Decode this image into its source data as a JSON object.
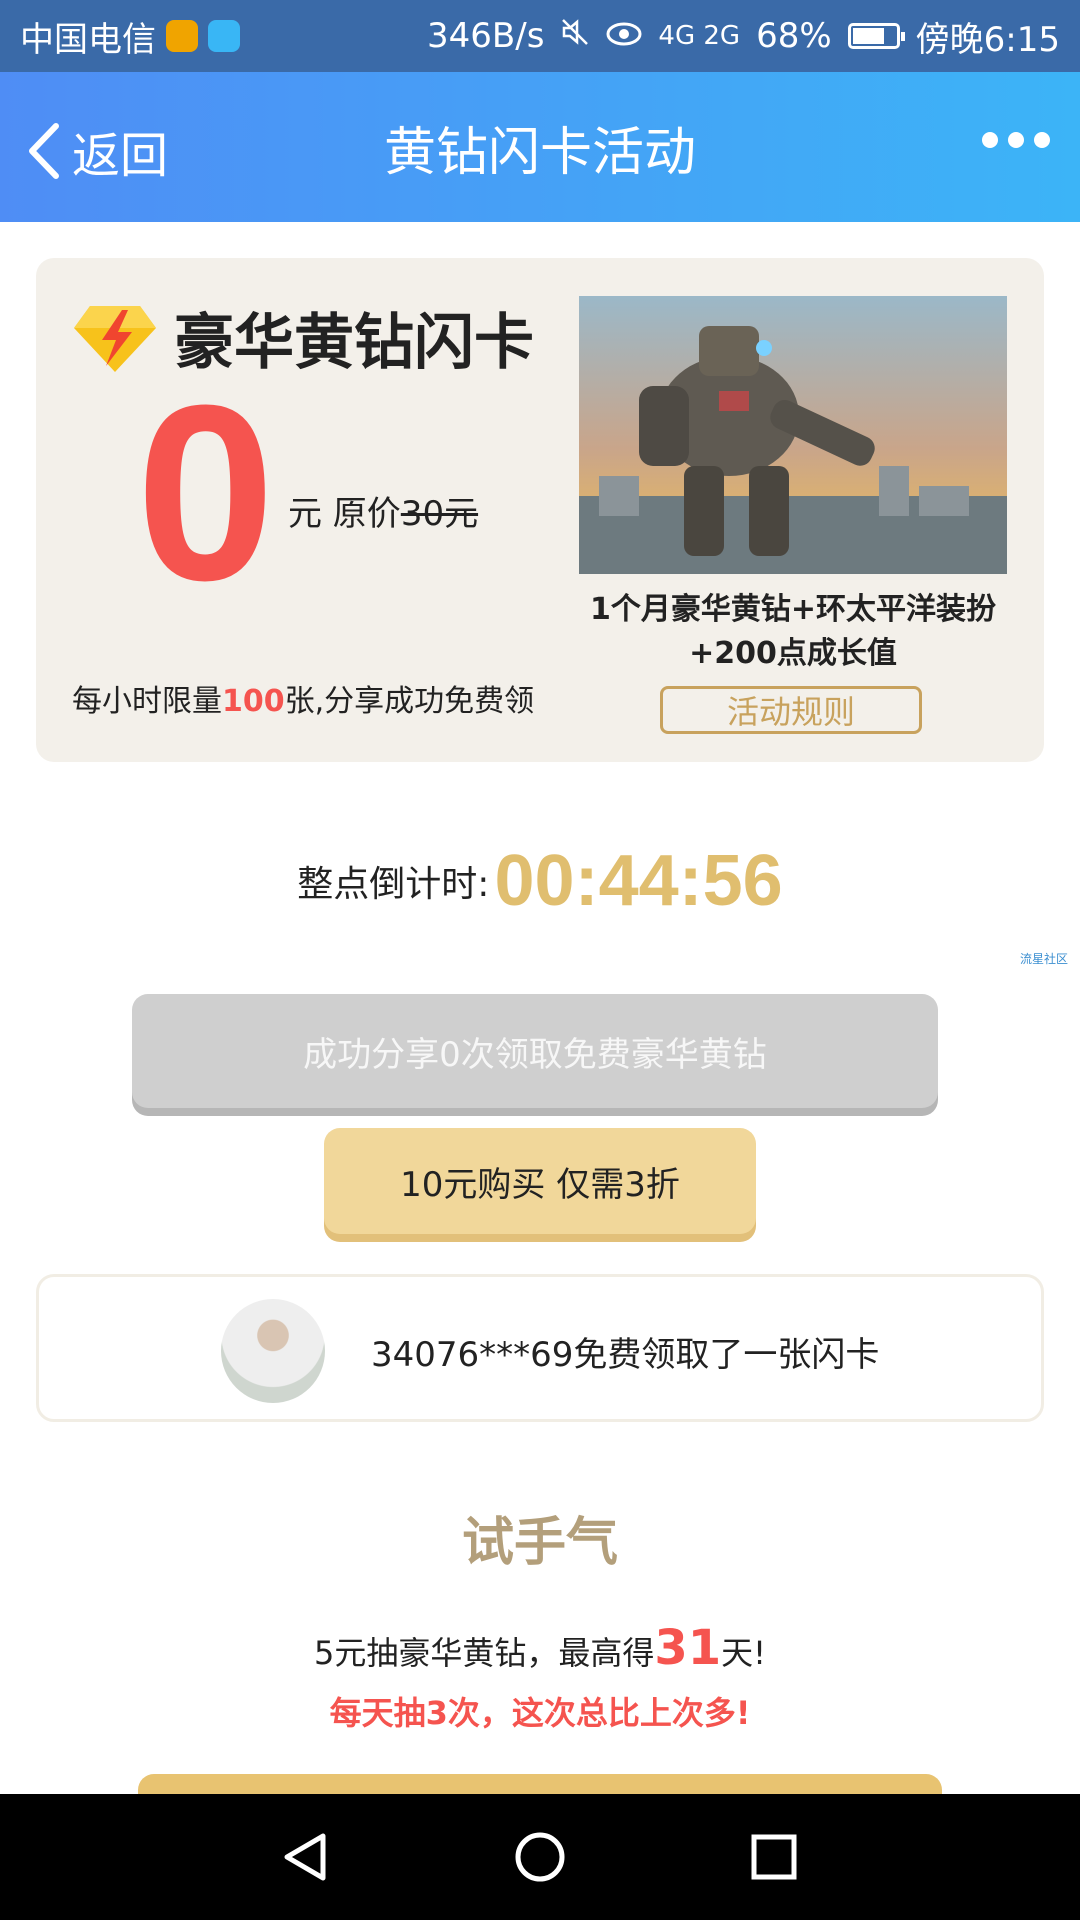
{
  "status_bar": {
    "carrier": "中国电信",
    "speed": "346B/s",
    "signal": "4G 2G",
    "battery": "68%",
    "battery_level": 0.68,
    "time": "傍晚6:15"
  },
  "header": {
    "back_label": "返回",
    "title": "黄钻闪卡活动"
  },
  "promo": {
    "brand_title": "豪华黄钻闪卡",
    "price": "0",
    "price_unit": "元 原价",
    "original_price": "30元",
    "limit_prefix": "每小时限量",
    "limit_count": "100",
    "limit_suffix": "张,分享成功免费领",
    "prize_line1": "1个月豪华黄钻+环太平洋装扮",
    "prize_line2": "+200点成长值",
    "rules_label": "活动规则"
  },
  "countdown": {
    "label": "整点倒计时:",
    "time": "00:44:56"
  },
  "watermark": "流星社区",
  "buttons": {
    "share_label": "成功分享0次领取免费豪华黄钻",
    "buy_label": "10元购买 仅需3折"
  },
  "feed": {
    "message": "34076***69免费领取了一张闪卡"
  },
  "luck": {
    "title": "试手气",
    "line_prefix": "5元抽豪华黄钻，最高得",
    "days": "31",
    "line_suffix": "天!",
    "note": "每天抽3次，这次总比上次多!"
  },
  "colors": {
    "header_start": "#4f8df5",
    "header_end": "#3cb4f7",
    "accent_red": "#f5544f",
    "gold": "#e0be6f",
    "card_bg": "#f3f0ea"
  }
}
